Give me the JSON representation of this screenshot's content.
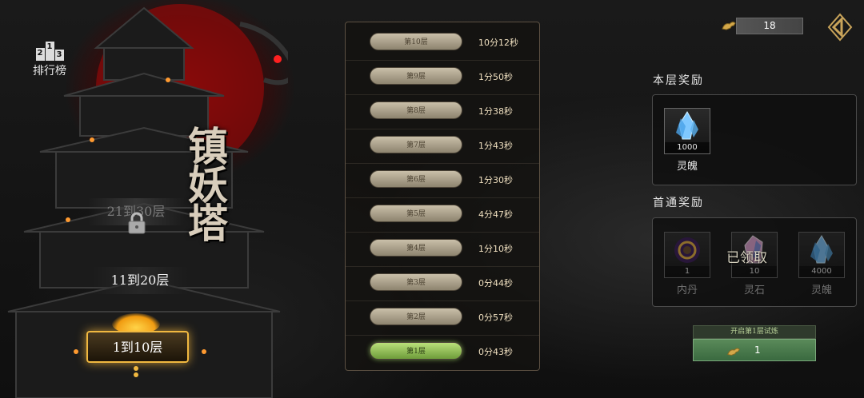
{
  "leaderboard": {
    "label": "排行榜",
    "digits": [
      "2",
      "1",
      "3"
    ]
  },
  "tower_title": "镇妖塔",
  "floor_ranges": {
    "locked": "21到30层",
    "mid": "11到20层",
    "active": "1到10层"
  },
  "floors": [
    {
      "label": "第10层",
      "time": "10分12秒"
    },
    {
      "label": "第9层",
      "time": "1分50秒"
    },
    {
      "label": "第8层",
      "time": "1分38秒"
    },
    {
      "label": "第7层",
      "time": "1分43秒"
    },
    {
      "label": "第6层",
      "time": "1分30秒"
    },
    {
      "label": "第5层",
      "time": "4分47秒"
    },
    {
      "label": "第4层",
      "time": "1分10秒"
    },
    {
      "label": "第3层",
      "time": "0分44秒"
    },
    {
      "label": "第2层",
      "time": "0分57秒"
    },
    {
      "label": "第1层",
      "time": "0分43秒"
    }
  ],
  "currency": {
    "amount": "18",
    "icon": "golden-beast-ticket-icon"
  },
  "floor_reward": {
    "title": "本层奖励",
    "items": [
      {
        "name": "灵魄",
        "count": "1000",
        "icon": "blue-crystal-icon"
      }
    ]
  },
  "first_clear_reward": {
    "title": "首通奖励",
    "claimed_text": "已领取",
    "items": [
      {
        "name": "内丹",
        "count": "1",
        "icon": "golden-orb-icon"
      },
      {
        "name": "灵石",
        "count": "10",
        "icon": "pink-crystal-icon"
      },
      {
        "name": "灵魄",
        "count": "4000",
        "icon": "blue-crystal-icon"
      }
    ]
  },
  "trial": {
    "label": "开启第1层试炼",
    "cost": "1"
  },
  "colors": {
    "accent_gold": "#f0b840",
    "current_floor_green": "#8cc050",
    "trial_green": "#4a7a4c"
  }
}
